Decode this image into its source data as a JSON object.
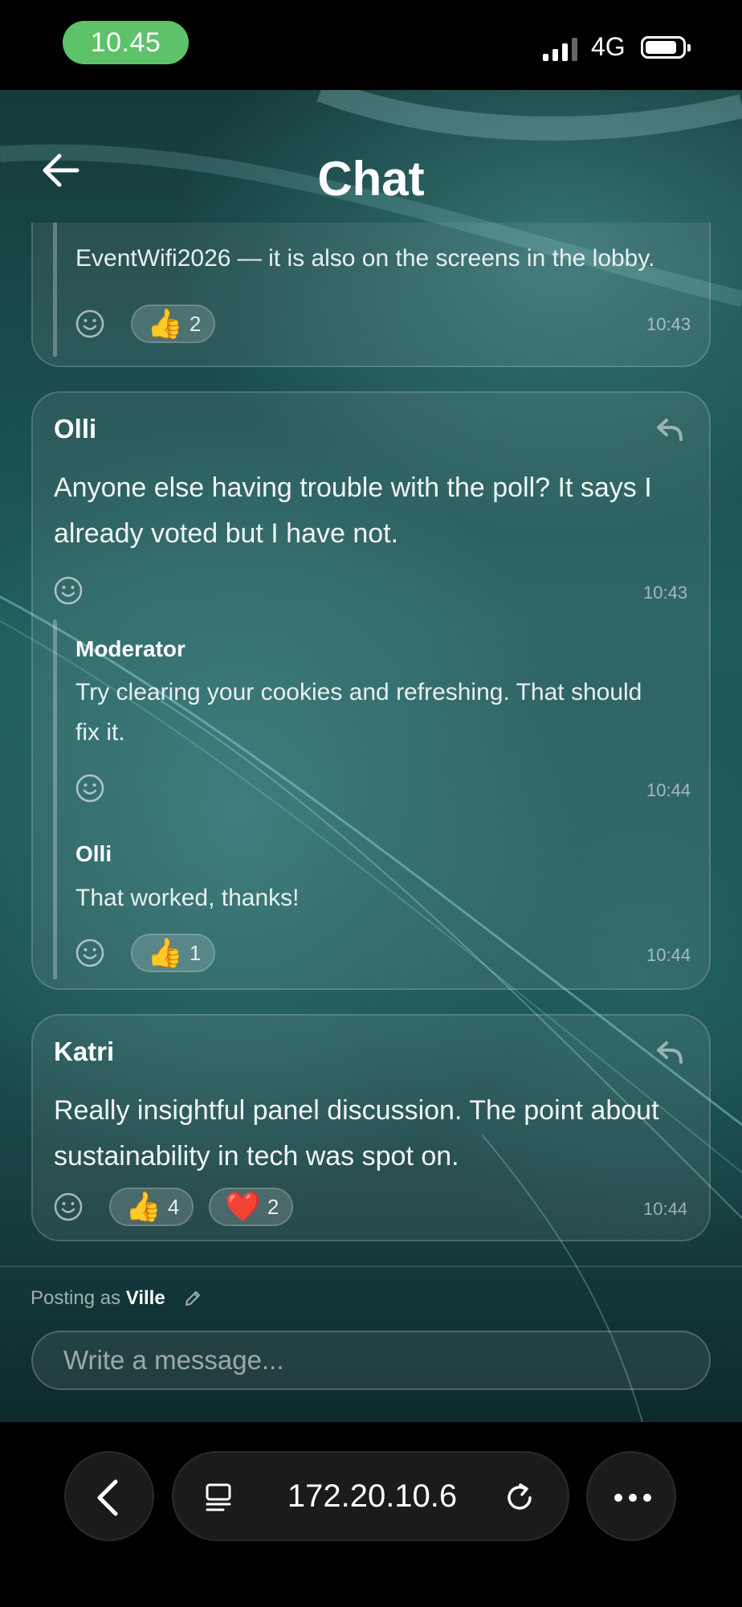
{
  "status_bar": {
    "time": "10.45",
    "network": "4G"
  },
  "header": {
    "title": "Chat"
  },
  "messages": [
    {
      "text": "EventWifi2026 — it is also on the screens in the lobby.",
      "time": "10:43",
      "reactions": [
        {
          "emoji": "👍",
          "count": "2"
        }
      ]
    },
    {
      "author": "Olli",
      "text": "Anyone else having trouble with the poll? It says I already voted but I have not.",
      "time": "10:43",
      "replies": [
        {
          "author": "Moderator",
          "text": "Try clearing your cookies and refreshing. That should fix it.",
          "time": "10:44",
          "reactions": []
        },
        {
          "author": "Olli",
          "text": "That worked, thanks!",
          "time": "10:44",
          "reactions": [
            {
              "emoji": "👍",
              "count": "1"
            }
          ]
        }
      ]
    },
    {
      "author": "Katri",
      "text": "Really insightful panel discussion. The point about sustainability in tech was spot on.",
      "time": "10:44",
      "reactions": [
        {
          "emoji": "👍",
          "count": "4"
        },
        {
          "emoji": "❤️",
          "count": "2"
        }
      ]
    }
  ],
  "composer": {
    "posting_as_label": "Posting as",
    "user": "Ville",
    "placeholder": "Write a message..."
  },
  "browser": {
    "url": "172.20.10.6"
  },
  "icons": {
    "back": "arrow-left-icon",
    "reply": "reply-icon",
    "add_reaction": "smiley-icon",
    "edit": "pencil-icon",
    "nav_back": "chevron-left-icon",
    "tabs": "tab-overview-icon",
    "reload": "reload-icon",
    "more": "ellipsis-icon"
  },
  "colors": {
    "time_pill": "#5ec26a",
    "background": "#1f5a5a"
  }
}
